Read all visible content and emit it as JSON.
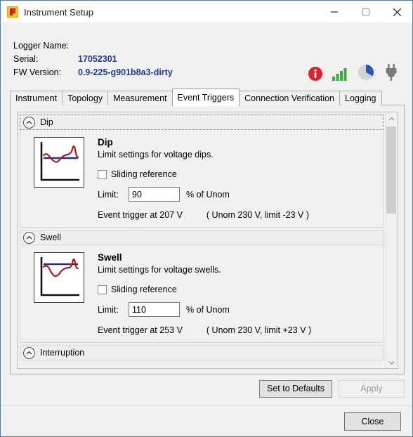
{
  "window": {
    "title": "Instrument Setup",
    "app_icon": "fluke-logo-icon",
    "controls": {
      "minimize": "minimize-icon",
      "maximize": "maximize-icon",
      "close": "close-icon"
    }
  },
  "info": {
    "rows": [
      {
        "label": "Logger Name:",
        "value": ""
      },
      {
        "label": "Serial:",
        "value": "17052301"
      },
      {
        "label": "FW Version:",
        "value": "0.9-225-g901b8a3-dirty"
      }
    ],
    "status_icons": [
      {
        "name": "info-icon",
        "color": "#d9232e"
      },
      {
        "name": "signal-strength-icon",
        "color": "#3faa3f"
      },
      {
        "name": "memory-pie-icon",
        "color": "#2b54b8"
      },
      {
        "name": "power-plug-icon",
        "color": "#7a7a7a"
      }
    ]
  },
  "tabs": [
    {
      "label": "Instrument",
      "active": false
    },
    {
      "label": "Topology",
      "active": false
    },
    {
      "label": "Measurement",
      "active": false
    },
    {
      "label": "Event Triggers",
      "active": true
    },
    {
      "label": "Connection Verification",
      "active": false
    },
    {
      "label": "Logging",
      "active": false
    }
  ],
  "groups": {
    "dip": {
      "header": "Dip",
      "title": "Dip",
      "description": "Limit settings for voltage dips.",
      "sliding_reference_label": "Sliding reference",
      "sliding_reference_checked": false,
      "limit_label": "Limit:",
      "limit_value": "90",
      "limit_unit": "% of Unom",
      "trigger_text": "Event trigger at 207 V",
      "trigger_note": "( Unom 230  V,  limit -23 V )",
      "thumbnail": "voltage-dip-waveform-icon"
    },
    "swell": {
      "header": "Swell",
      "title": "Swell",
      "description": "Limit settings for voltage swells.",
      "sliding_reference_label": "Sliding reference",
      "sliding_reference_checked": false,
      "limit_label": "Limit:",
      "limit_value": "110",
      "limit_unit": "% of Unom",
      "trigger_text": "Event trigger at 253 V",
      "trigger_note": "( Unom 230  V,  limit +23 V )",
      "thumbnail": "voltage-swell-waveform-icon"
    },
    "interruption": {
      "header": "Interruption"
    }
  },
  "buttons": {
    "set_defaults": "Set to Defaults",
    "apply": "Apply",
    "apply_disabled": true,
    "close": "Close"
  },
  "scrollbar": {
    "up_arrow": "chevron-up-icon",
    "down_arrow": "chevron-down-icon"
  }
}
